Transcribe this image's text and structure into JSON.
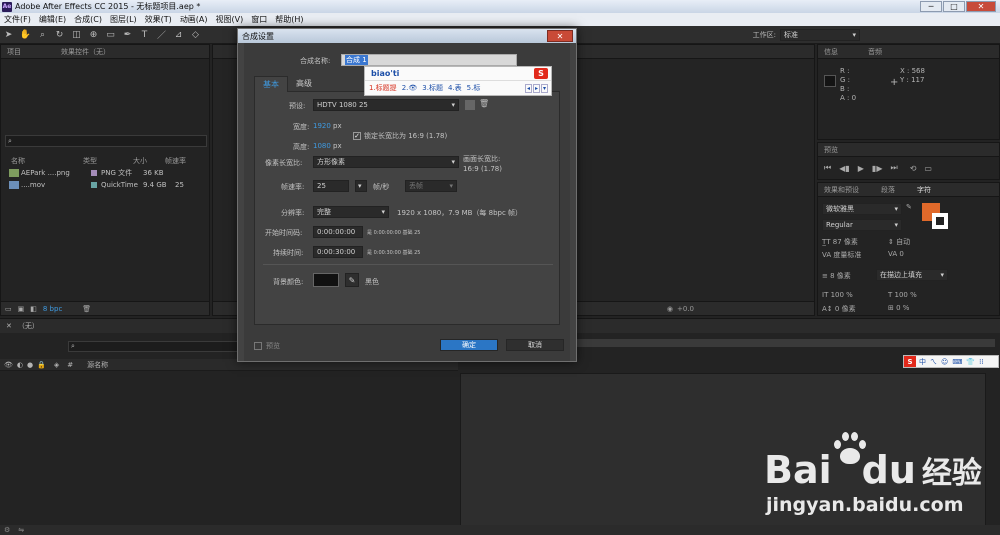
{
  "window": {
    "title": "Adobe After Effects CC 2015 - 无标题项目.aep *",
    "logo": "Ae",
    "min": "─",
    "max": "□",
    "close": "✕"
  },
  "menu": [
    "文件(F)",
    "编辑(E)",
    "合成(C)",
    "图层(L)",
    "效果(T)",
    "动画(A)",
    "视图(V)",
    "窗口",
    "帮助(H)"
  ],
  "toolbar": {
    "workspace_label": "工作区:",
    "workspace_value": "标准"
  },
  "project_panel": {
    "tab_project": "项目",
    "tab_effects": "效果控件（无）",
    "columns": [
      "名称",
      "类型",
      "大小",
      "帧速率"
    ],
    "items": [
      {
        "name": "AEPark ....png",
        "type": "PNG 文件",
        "size": "36 KB",
        "fps": ""
      },
      {
        "name": "....mov",
        "type": "QuickTime",
        "size": "9.4 GB",
        "fps": "25"
      }
    ],
    "bpc": "8 bpc"
  },
  "info_panel": {
    "tab_info": "信息",
    "tab_audio": "音频",
    "r": "R :",
    "g": "G :",
    "b": "B :",
    "a": "A : 0",
    "x": "X : 568",
    "y": "Y : 117"
  },
  "preview_panel": {
    "tab": "预览"
  },
  "effects_panel": {
    "tab_effects": "效果和预设",
    "tab_para": "段落",
    "tab_char": "字符",
    "font": "微软雅黑",
    "style": "Regular",
    "size": "87 像素",
    "leading": "自动",
    "kern": "度量标准",
    "tracking": "0",
    "stroke": "8 像素",
    "stroke_mode": "在描边上填充",
    "vscale": "100 %",
    "hscale": "100 %",
    "baseline": "0 像素",
    "tsume": "0 %"
  },
  "comp_panel": {
    "zoom": "+0.0"
  },
  "timeline": {
    "tab_close": "✕",
    "tab_name": "（无）",
    "layer_col": "源名称"
  },
  "dialog": {
    "title": "合成设置",
    "close": "✕",
    "name_label": "合成名称:",
    "name_value": "合成 1",
    "tabs": [
      "基本",
      "高级"
    ],
    "preset_label": "预设:",
    "preset_value": "HDTV 1080 25",
    "width_label": "宽度:",
    "width_value": "1920",
    "height_label": "高度:",
    "height_value": "1080",
    "px": "px",
    "lock_label": "锁定长宽比为 16:9 (1.78)",
    "par_label": "像素长宽比:",
    "par_value": "方形像素",
    "frame_aspect_label": "画面长宽比:",
    "frame_aspect_value": "16:9 (1.78)",
    "fps_label": "帧速率:",
    "fps_value": "25",
    "fps_unit": "帧/秒",
    "drop_frame": "丢帧",
    "res_label": "分辨率:",
    "res_value": "完整",
    "res_info": "1920 x 1080，7.9 MB（每 8bpc 帧）",
    "start_label": "开始时间码:",
    "start_value": "0:00:00:00",
    "start_info": "是 0:00:00:00 基础 25",
    "dur_label": "持续时间:",
    "dur_value": "0:00:30:00",
    "dur_info": "是 0:00:30:00 基础 25",
    "bg_label": "背景颜色:",
    "bg_name": "黑色",
    "preview_label": "预览",
    "ok": "确定",
    "cancel": "取消"
  },
  "ime": {
    "input": "biao'ti",
    "candidates": [
      "1.标题提",
      "2.👁",
      "3.标题",
      "4.表",
      "5.标"
    ]
  },
  "ime_bar": {
    "items": [
      "中",
      "ㄟ",
      "☺",
      "⌨",
      "👕",
      "⁞⁞"
    ]
  },
  "watermark": {
    "brand": "Bai",
    "brand2": "du",
    "text": "经验",
    "url": "jingyan.baidu.com"
  }
}
